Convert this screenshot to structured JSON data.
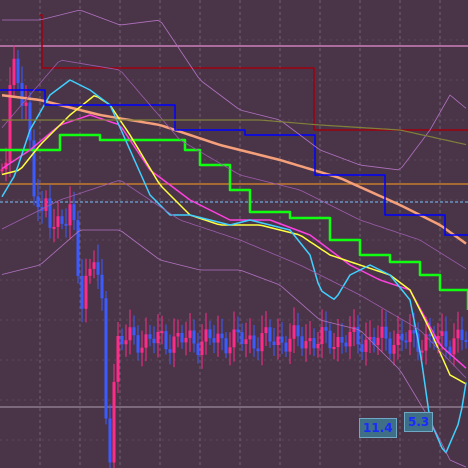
{
  "chart_data": {
    "type": "candlestick",
    "x_range": [
      0,
      117
    ],
    "y_range": [
      0,
      468
    ],
    "candle_count": 117,
    "candle_up_color": "#ff2a8a",
    "candle_down_color": "#3a5cff",
    "background_color": "#4a3548",
    "grid": true,
    "annotations": [
      "11.4",
      "5.3"
    ],
    "annotation_colors": {
      "text": "#1a2aff",
      "fill": "#3f6f86"
    },
    "horizontal_levels": [
      {
        "name": "pink-level",
        "color": "#e58fd0",
        "y": 46
      },
      {
        "name": "orange-level",
        "color": "#e08a2a",
        "y": 184
      },
      {
        "name": "blue-dash-level",
        "color": "#6fa8d8",
        "y": 202
      },
      {
        "name": "grey-level",
        "color": "#9a8a9a",
        "y": 407
      }
    ],
    "candles": [],
    "series": []
  }
}
